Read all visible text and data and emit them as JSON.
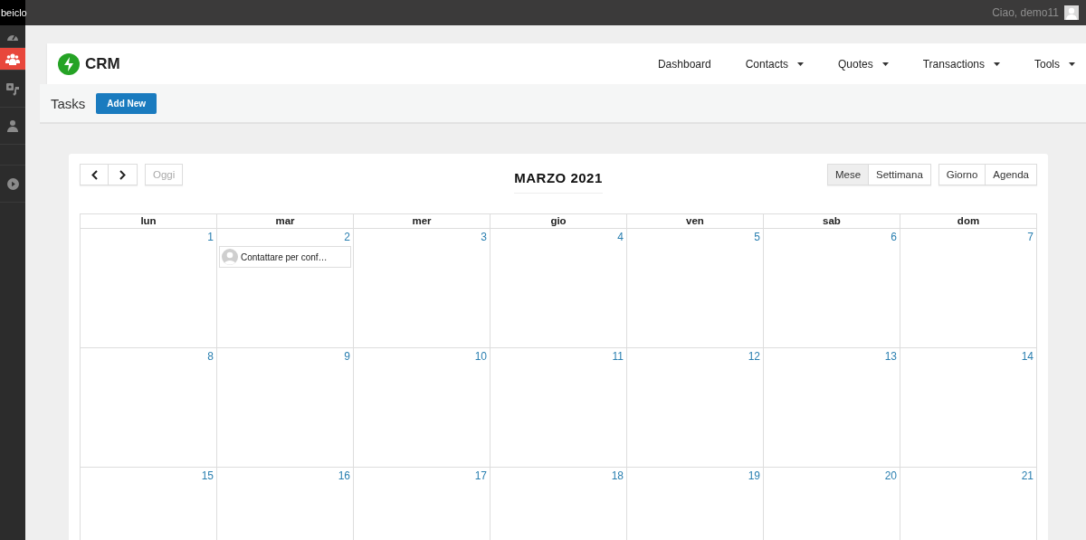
{
  "brand": "beiclo",
  "user": {
    "greeting": "Ciao, demo11"
  },
  "sidebar": {
    "items": [
      {
        "selected": false
      },
      {
        "selected": true
      },
      {
        "selected": false
      },
      {
        "selected": false
      },
      {
        "selected": false
      }
    ]
  },
  "app": {
    "title": "CRM"
  },
  "nav": [
    {
      "label": "Dashboard",
      "has_menu": false
    },
    {
      "label": "Contacts",
      "has_menu": true
    },
    {
      "label": "Quotes",
      "has_menu": true
    },
    {
      "label": "Transactions",
      "has_menu": true
    },
    {
      "label": "Tools",
      "has_menu": true
    }
  ],
  "page": {
    "title": "Tasks",
    "add_button": "Add New"
  },
  "calendar": {
    "title": "MARZO 2021",
    "today_button": "Oggi",
    "today_disabled": true,
    "views": [
      [
        {
          "label": "Mese",
          "selected": true
        },
        {
          "label": "Settimana",
          "selected": false
        }
      ],
      [
        {
          "label": "Giorno",
          "selected": false
        },
        {
          "label": "Agenda",
          "selected": false
        }
      ]
    ],
    "weekdays": [
      "lun",
      "mar",
      "mer",
      "gio",
      "ven",
      "sab",
      "dom"
    ],
    "weeks": [
      [
        {
          "day": "1"
        },
        {
          "day": "2",
          "events": [
            "Contattare per conf…"
          ]
        },
        {
          "day": "3"
        },
        {
          "day": "4"
        },
        {
          "day": "5"
        },
        {
          "day": "6"
        },
        {
          "day": "7"
        }
      ],
      [
        {
          "day": "8"
        },
        {
          "day": "9"
        },
        {
          "day": "10"
        },
        {
          "day": "11"
        },
        {
          "day": "12"
        },
        {
          "day": "13"
        },
        {
          "day": "14"
        }
      ],
      [
        {
          "day": "15"
        },
        {
          "day": "16"
        },
        {
          "day": "17"
        },
        {
          "day": "18"
        },
        {
          "day": "19"
        },
        {
          "day": "20"
        },
        {
          "day": "21"
        }
      ]
    ]
  }
}
